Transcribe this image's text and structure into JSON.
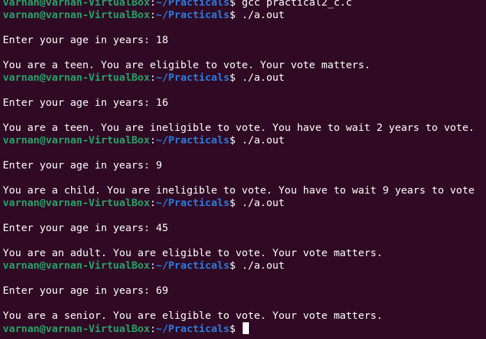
{
  "colors": {
    "background": "#300a24",
    "user_host": "#26a269",
    "path": "#2a7bde",
    "text": "#ffffff"
  },
  "prompt": {
    "user_host": "varnan@varnan-VirtualBox",
    "separator": ":",
    "path": "~/Practicals",
    "symbol": "$"
  },
  "lines": [
    {
      "type": "prompt",
      "command": " gcc practical2_c.c"
    },
    {
      "type": "prompt",
      "command": " ./a.out"
    },
    {
      "type": "blank",
      "text": ""
    },
    {
      "type": "output",
      "text": "Enter your age in years: 18"
    },
    {
      "type": "blank",
      "text": ""
    },
    {
      "type": "output",
      "text": "You are a teen. You are eligible to vote. Your vote matters."
    },
    {
      "type": "prompt",
      "command": " ./a.out"
    },
    {
      "type": "blank",
      "text": ""
    },
    {
      "type": "output",
      "text": "Enter your age in years: 16"
    },
    {
      "type": "blank",
      "text": ""
    },
    {
      "type": "output",
      "text": "You are a teen. You are ineligible to vote. You have to wait 2 years to vote."
    },
    {
      "type": "prompt",
      "command": " ./a.out"
    },
    {
      "type": "blank",
      "text": ""
    },
    {
      "type": "output",
      "text": "Enter your age in years: 9"
    },
    {
      "type": "blank",
      "text": ""
    },
    {
      "type": "output",
      "text": "You are a child. You are ineligible to vote. You have to wait 9 years to vote"
    },
    {
      "type": "prompt",
      "command": " ./a.out"
    },
    {
      "type": "blank",
      "text": ""
    },
    {
      "type": "output",
      "text": "Enter your age in years: 45"
    },
    {
      "type": "blank",
      "text": ""
    },
    {
      "type": "output",
      "text": "You are an adult. You are eligible to vote. Your vote matters."
    },
    {
      "type": "prompt",
      "command": " ./a.out"
    },
    {
      "type": "blank",
      "text": ""
    },
    {
      "type": "output",
      "text": "Enter your age in years: 69"
    },
    {
      "type": "blank",
      "text": ""
    },
    {
      "type": "output",
      "text": "You are a senior. You are eligible to vote. Your vote matters."
    },
    {
      "type": "prompt",
      "command": " ",
      "cursor": true
    }
  ]
}
